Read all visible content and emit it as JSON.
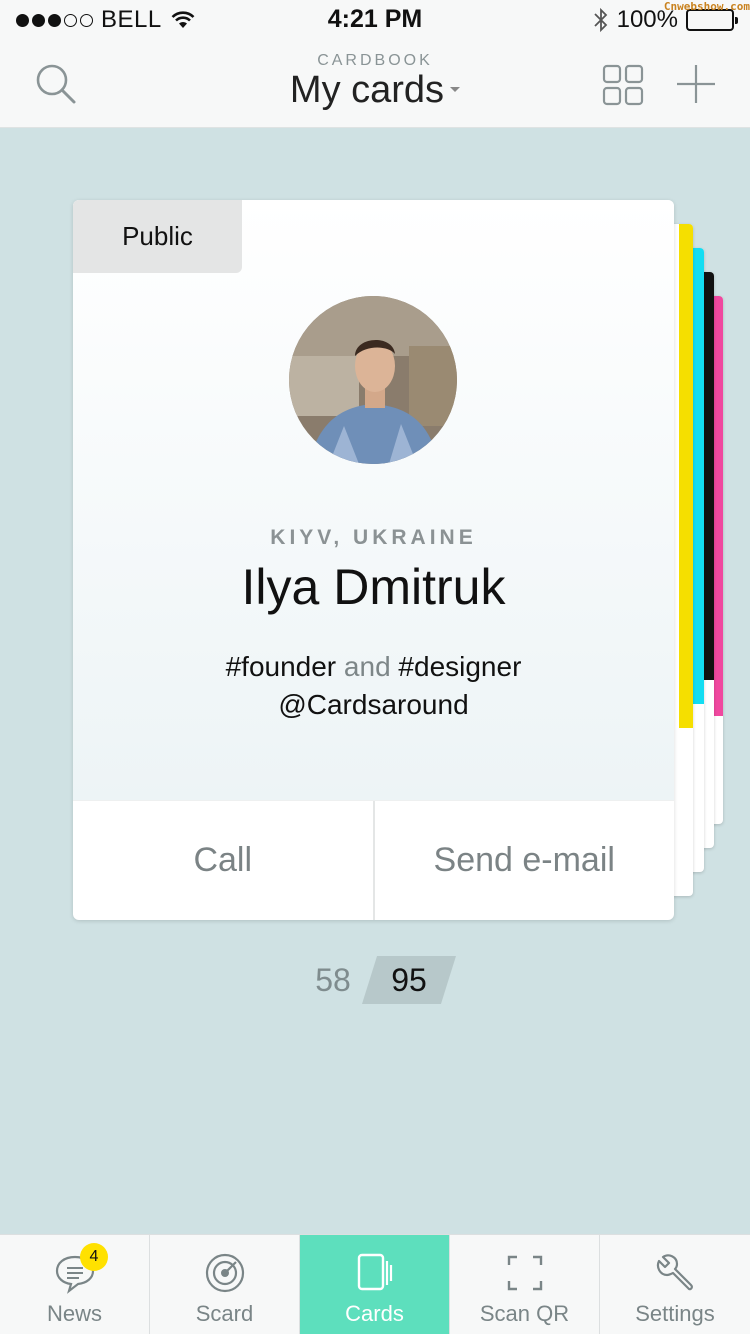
{
  "status_bar": {
    "carrier": "BELL",
    "time": "4:21 PM",
    "battery": "100%",
    "signal_bars_filled": 3,
    "watermark": "Cnwebshow.com"
  },
  "header": {
    "subtitle": "CARDBOOK",
    "title": "My cards"
  },
  "card": {
    "visibility": "Public",
    "location": "KIYV, UKRAINE",
    "name": "Ilya Dmitruk",
    "tag_1": "#founder",
    "tag_joiner": "and",
    "tag_2": "#designer",
    "handle": "@Cardsaround",
    "call_label": "Call",
    "email_label": "Send e-mail"
  },
  "stack_colors": [
    "#f5df00",
    "#13ddf2",
    "#111111",
    "#f0489f"
  ],
  "pager": {
    "previous": "58",
    "current": "95"
  },
  "tabs": [
    {
      "label": "News",
      "icon": "chat-bubble-icon",
      "badge": "4"
    },
    {
      "label": "Scard",
      "icon": "target-icon"
    },
    {
      "label": "Cards",
      "icon": "cards-icon",
      "active": true
    },
    {
      "label": "Scan QR",
      "icon": "scan-frame-icon"
    },
    {
      "label": "Settings",
      "icon": "wrench-icon"
    }
  ],
  "colors": {
    "background": "#cfe1e3",
    "active_tab": "#5ddfbd",
    "badge": "#ffe100"
  }
}
